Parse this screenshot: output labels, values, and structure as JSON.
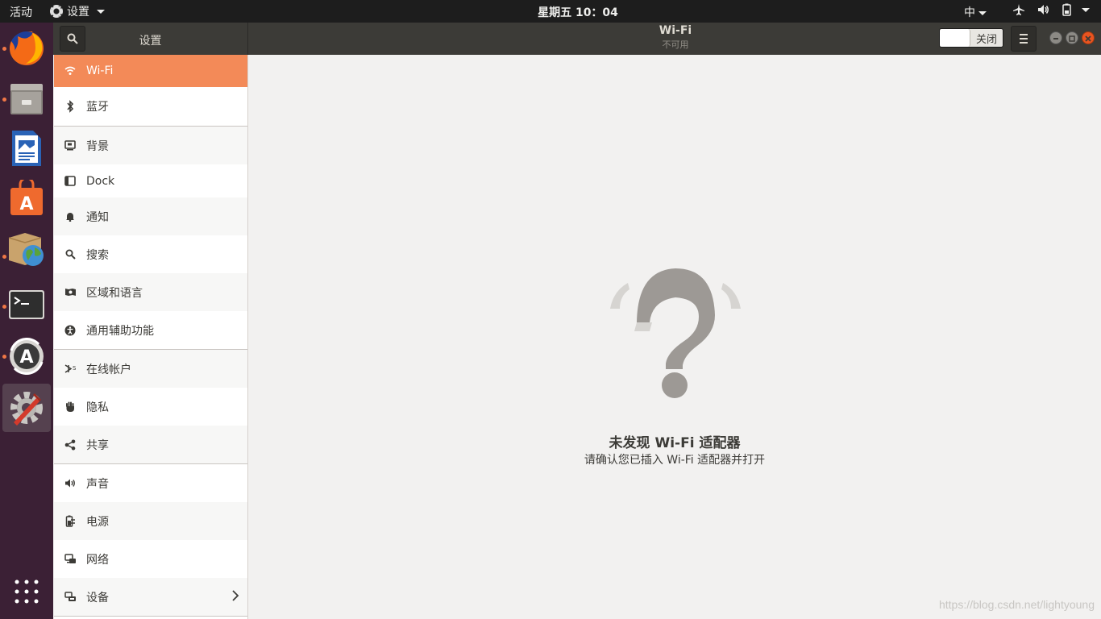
{
  "topbar": {
    "activities": "活动",
    "app_menu": "设置",
    "clock": "星期五 10：04",
    "ime": "中"
  },
  "dock": {
    "apps": [
      "firefox-icon",
      "files-icon",
      "libreoffice-writer-icon",
      "software-center-icon",
      "archive-globe-icon",
      "terminal-icon",
      "software-updater-icon",
      "settings-tools-icon"
    ]
  },
  "header": {
    "sidebar_title": "设置",
    "title": "Wi-Fi",
    "subtitle": "不可用",
    "switch_label": "关闭"
  },
  "sidebar": {
    "items": [
      {
        "label": "Wi-Fi",
        "icon": "wifi-icon",
        "selected": true
      },
      {
        "label": "蓝牙",
        "icon": "bluetooth-icon"
      },
      {
        "label": "背景",
        "icon": "background-icon"
      },
      {
        "label": "Dock",
        "icon": "dock-icon"
      },
      {
        "label": "通知",
        "icon": "bell-icon"
      },
      {
        "label": "搜索",
        "icon": "search-icon"
      },
      {
        "label": "区域和语言",
        "icon": "region-icon"
      },
      {
        "label": "通用辅助功能",
        "icon": "accessibility-icon"
      },
      {
        "label": "在线帐户",
        "icon": "online-accounts-icon"
      },
      {
        "label": "隐私",
        "icon": "hand-icon"
      },
      {
        "label": "共享",
        "icon": "share-icon"
      },
      {
        "label": "声音",
        "icon": "speaker-icon"
      },
      {
        "label": "电源",
        "icon": "power-icon"
      },
      {
        "label": "网络",
        "icon": "network-icon"
      },
      {
        "label": "设备",
        "icon": "devices-icon"
      }
    ]
  },
  "main": {
    "title": "未发现 Wi-Fi 适配器",
    "subtitle": "请确认您已插入 Wi-Fi 适配器并打开"
  },
  "watermark": "https://blog.csdn.net/lightyoung",
  "colors": {
    "accent": "#f38a58",
    "dock_bg": "#3b2035",
    "headerbar_bg": "#3c3b37"
  }
}
